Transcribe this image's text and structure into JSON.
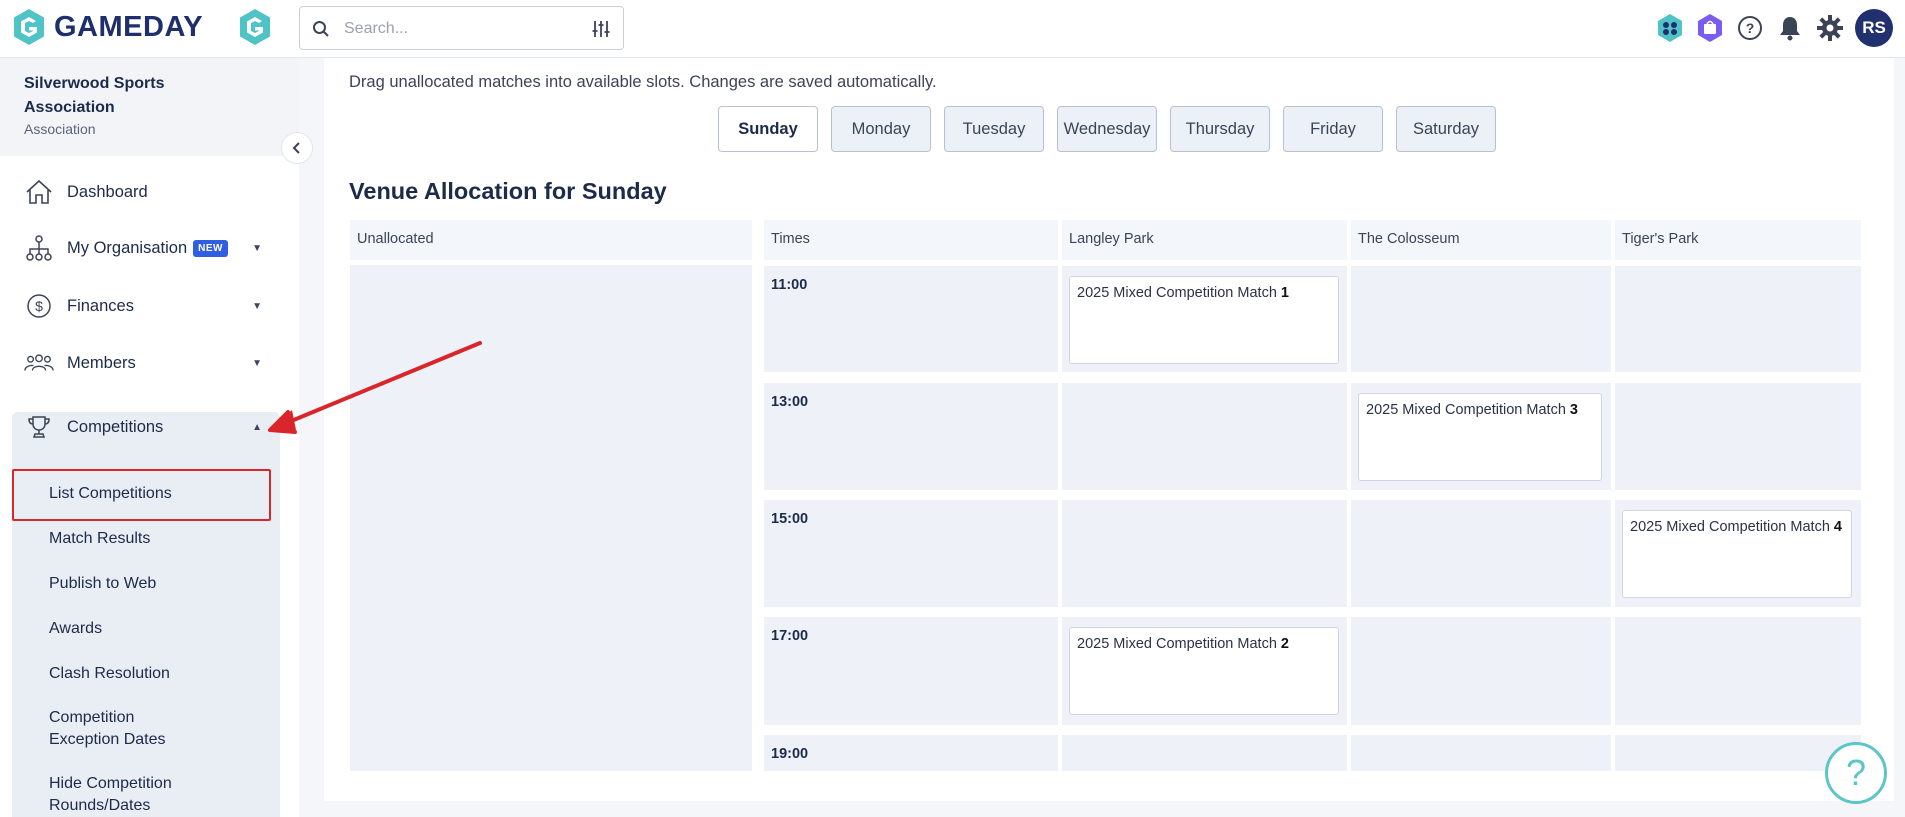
{
  "header": {
    "brand": "GAMEDAY",
    "search_placeholder": "Search...",
    "avatar_initials": "RS",
    "icons": [
      "gameday-g-icon",
      "search-icon",
      "filter-sliders-icon",
      "apps-icon",
      "shop-icon",
      "help-circle-icon",
      "bell-icon",
      "gear-icon"
    ]
  },
  "sidebar": {
    "org_name": "Silverwood Sports Association",
    "org_type": "Association",
    "items": [
      {
        "label": "Dashboard",
        "icon": "home-icon"
      },
      {
        "label": "My Organisation",
        "icon": "org-chart-icon",
        "badge": "NEW"
      },
      {
        "label": "Finances",
        "icon": "dollar-icon"
      },
      {
        "label": "Members",
        "icon": "people-icon"
      },
      {
        "label": "Competitions",
        "icon": "trophy-icon"
      }
    ],
    "competition_subitems": [
      "List Competitions",
      "Match Results",
      "Publish to Web",
      "Awards",
      "Clash Resolution",
      "Competition Exception Dates",
      "Hide Competition Rounds/Dates"
    ]
  },
  "main": {
    "hint": "Drag unallocated matches into available slots. Changes are saved automatically.",
    "days": [
      "Sunday",
      "Monday",
      "Tuesday",
      "Wednesday",
      "Thursday",
      "Friday",
      "Saturday"
    ],
    "selected_day": "Sunday",
    "title": "Venue Allocation for Sunday",
    "unallocated_label": "Unallocated",
    "times_label": "Times",
    "venues": [
      "Langley Park",
      "The Colosseum",
      "Tiger's Park"
    ],
    "times": [
      "11:00",
      "13:00",
      "15:00",
      "17:00",
      "19:00"
    ],
    "matches": [
      {
        "prefix": "2025 Mixed Competition Match",
        "number": "1"
      },
      {
        "prefix": "2025 Mixed Competition Match",
        "number": "3"
      },
      {
        "prefix": "2025 Mixed Competition Match",
        "number": "4"
      },
      {
        "prefix": "2025 Mixed Competition Match",
        "number": "2"
      }
    ]
  },
  "colors": {
    "brand_navy": "#1f2f6b",
    "brand_teal": "#4fc3c6",
    "highlight_red": "#d8262a",
    "badge_blue": "#2f5fe0"
  }
}
